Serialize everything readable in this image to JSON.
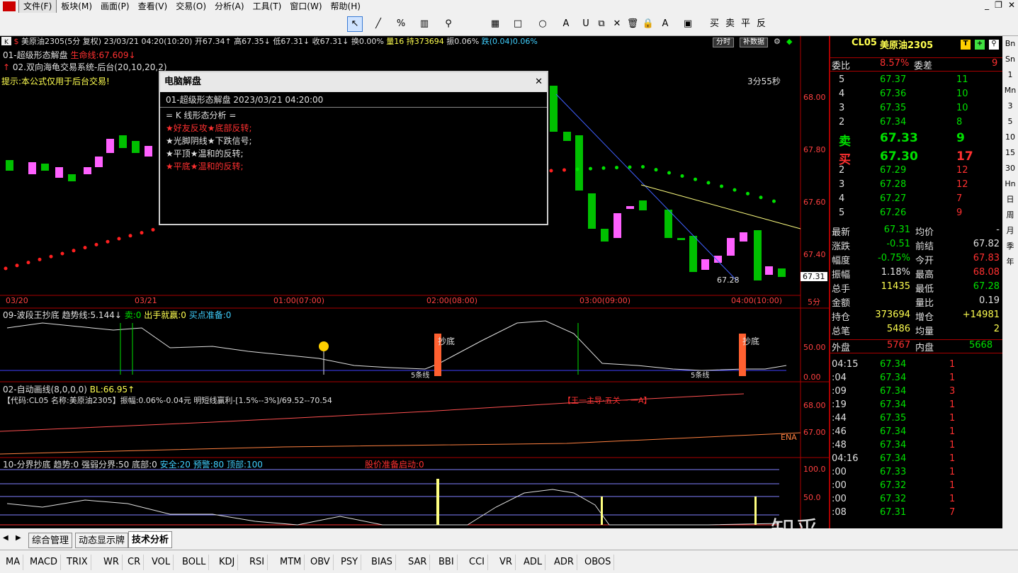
{
  "menu": {
    "items": [
      "文件(F)",
      "板块(M)",
      "画面(P)",
      "查看(V)",
      "交易(O)",
      "分析(A)",
      "工具(T)",
      "窗口(W)",
      "帮助(H)"
    ]
  },
  "toolbar": {
    "buttons": [
      "↖",
      "╱",
      "%",
      "▥",
      "⚲",
      "▦",
      "□",
      "○",
      "A",
      "U",
      "⧉",
      "✕",
      "🗑",
      "🔒",
      "A",
      "▣"
    ],
    "trade": [
      "买",
      "卖",
      "平",
      "反"
    ]
  },
  "header": {
    "symbol": "美原油2305(5分 复权)",
    "datetime": "23/03/21 04:20(10:20)",
    "open": "开67.34↑",
    "high": "高67.35↓",
    "low": "低67.31↓",
    "close": "收67.31↓",
    "turnover": "换0.00%",
    "volume": "量16",
    "hold": "持373694",
    "amp": "振0.06%",
    "change": "跌(0.04)0.06%",
    "btn_time": "分时",
    "btn_bu": "补数据"
  },
  "formula": {
    "name": "01-超级形态解盘",
    "life": "生命线:67.609↓",
    "second": "02.双向海龟交易系统-后台(20,10,20,2)",
    "tip": "提示:本公式仅用于后台交易!",
    "countdown": "3分55秒",
    "last_low": "67.28"
  },
  "price_axis": [
    "68.00",
    "67.80",
    "67.60",
    "67.40"
  ],
  "price_tag": "67.31",
  "time_axis": [
    "03/20",
    "03/21",
    "01:00(07:00)",
    "02:00(08:00)",
    "03:00(09:00)",
    "04:00(10:00)",
    "5分"
  ],
  "popup": {
    "title": "电脑解盘",
    "sub": "01-超级形态解盘   2023/03/21 04:20:00",
    "header": "=  K 线形态分析  =",
    "lines": [
      {
        "text": "★好友反攻★底部反转;",
        "color": "#ff3030"
      },
      {
        "text": "★光脚阴线★下跌信号;",
        "color": "#e0e0e0"
      },
      {
        "text": "★平顶★温和的反转;",
        "color": "#e0e0e0"
      },
      {
        "text": "★平底★温和的反转;",
        "color": "#ff3030"
      }
    ]
  },
  "panel2": {
    "title": "09-波段王抄底",
    "trend": "趋势线:5.144↓",
    "sell": "卖:0",
    "out": "出手就赢:0",
    "buy": "买点准备:0",
    "axis": [
      "50.00",
      "0.00"
    ],
    "labels": [
      "抄底",
      "抄底",
      "5条线",
      "5条线"
    ]
  },
  "panel3": {
    "title": "02-自动画线(8,0,0,0)",
    "bl": "BL:66.95↑",
    "line2": "【代码:CL05 名称:美原油2305】振幅:0.06%-0.04元 明短线赢利-[1.5%--3%]/69.52--70.54",
    "red_tag": "【王一主导·五关一 一A】",
    "axis": [
      "68.00",
      "67.00"
    ],
    "ena": "ENA"
  },
  "panel4": {
    "title": "10-分界抄底",
    "trend": "趋势:0",
    "strong": "强弱分界:50",
    "bottom": "底部:0",
    "safe": "安全:20",
    "warn": "预警:80",
    "top": "顶部:100",
    "ready": "股价准备启动:0",
    "axis": [
      "100.0",
      "50.0"
    ]
  },
  "quote": {
    "code": "CL05",
    "name": "美原油2305",
    "weibi_label": "委比",
    "weibi": "8.57%",
    "weicha_label": "委差",
    "weicha": "9",
    "asks": [
      {
        "lvl": "5",
        "p": "67.37",
        "v": "11"
      },
      {
        "lvl": "4",
        "p": "67.36",
        "v": "10"
      },
      {
        "lvl": "3",
        "p": "67.35",
        "v": "10"
      },
      {
        "lvl": "2",
        "p": "67.34",
        "v": "8"
      }
    ],
    "sell1": {
      "lvl": "卖",
      "p": "67.33",
      "v": "9"
    },
    "buy1": {
      "lvl": "买",
      "p": "67.30",
      "v": "17"
    },
    "bids": [
      {
        "lvl": "2",
        "p": "67.29",
        "v": "12"
      },
      {
        "lvl": "3",
        "p": "67.28",
        "v": "12"
      },
      {
        "lvl": "4",
        "p": "67.27",
        "v": "7"
      },
      {
        "lvl": "5",
        "p": "67.26",
        "v": "9"
      }
    ],
    "stats": [
      {
        "l1": "最新",
        "v1": "67.31",
        "c1": "#00e000",
        "l2": "均价",
        "v2": "-",
        "c2": "#e0e0e0"
      },
      {
        "l1": "涨跌",
        "v1": "-0.51",
        "c1": "#00e000",
        "l2": "前结",
        "v2": "67.82",
        "c2": "#e0e0e0"
      },
      {
        "l1": "幅度",
        "v1": "-0.75%",
        "c1": "#00e000",
        "l2": "今开",
        "v2": "67.83",
        "c2": "#ff3030"
      },
      {
        "l1": "振幅",
        "v1": "1.18%",
        "c1": "#e0e0e0",
        "l2": "最高",
        "v2": "68.08",
        "c2": "#ff3030"
      },
      {
        "l1": "总手",
        "v1": "11435",
        "c1": "#ffff50",
        "l2": "最低",
        "v2": "67.28",
        "c2": "#00e000"
      },
      {
        "l1": "金额",
        "v1": "",
        "c1": "#e0e0e0",
        "l2": "量比",
        "v2": "0.19",
        "c2": "#e0e0e0"
      },
      {
        "l1": "持仓",
        "v1": "373694",
        "c1": "#ffff50",
        "l2": "增仓",
        "v2": "+14981",
        "c2": "#ffff50"
      },
      {
        "l1": "总笔",
        "v1": "5486",
        "c1": "#ffff50",
        "l2": "均量",
        "v2": "2",
        "c2": "#ffff50"
      }
    ],
    "waipan_label": "外盘",
    "waipan": "5767",
    "neipan_label": "内盘",
    "neipan": "5668",
    "ticks": [
      {
        "t": "04:15",
        "p": "67.34",
        "v": "1"
      },
      {
        "t": ":04",
        "p": "67.34",
        "v": "1"
      },
      {
        "t": ":09",
        "p": "67.34",
        "v": "3"
      },
      {
        "t": ":19",
        "p": "67.34",
        "v": "1"
      },
      {
        "t": ":44",
        "p": "67.35",
        "v": "1"
      },
      {
        "t": ":46",
        "p": "67.34",
        "v": "1"
      },
      {
        "t": ":48",
        "p": "67.34",
        "v": "1"
      },
      {
        "t": "04:16",
        "p": "67.34",
        "v": "1"
      },
      {
        "t": ":00",
        "p": "67.33",
        "v": "1"
      },
      {
        "t": ":00",
        "p": "67.32",
        "v": "1"
      },
      {
        "t": ":00",
        "p": "67.32",
        "v": "1"
      },
      {
        "t": ":08",
        "p": "67.31",
        "v": "7"
      }
    ]
  },
  "sidebar": [
    "Bn",
    "Sn",
    "1",
    "Mn",
    "3",
    "5",
    "10",
    "15",
    "30",
    "Hn",
    "日",
    "周",
    "月",
    "季",
    "年"
  ],
  "bottom_tabs": [
    "综合管理",
    "动态显示牌",
    "技术分析"
  ],
  "indicators": [
    "MA",
    "MACD",
    "TRIX",
    "WR",
    "CR",
    "VOL",
    "BOLL",
    "KDJ",
    "RSI",
    "MTM",
    "OBV",
    "PSY",
    "BIAS",
    "SAR",
    "BBI",
    "CCI",
    "VR",
    "ADL",
    "ADR",
    "OBOS"
  ],
  "watermark": "知乎 @恒指开户"
}
